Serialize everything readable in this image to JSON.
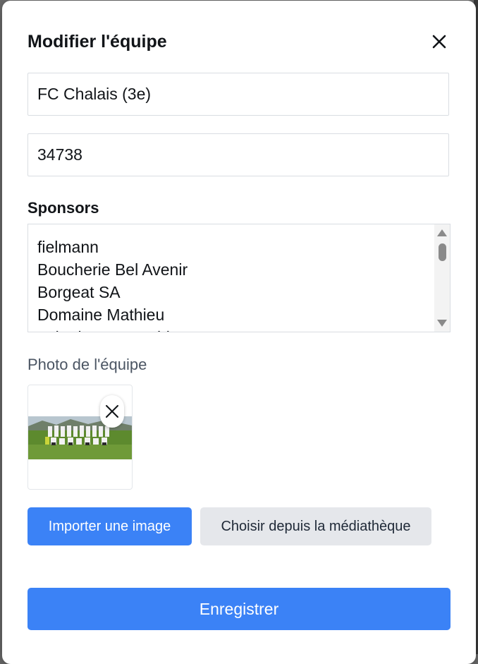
{
  "modal": {
    "title": "Modifier l'équipe",
    "close_icon": "close-icon"
  },
  "form": {
    "team_name": "FC Chalais (3e)",
    "team_id": "34738",
    "sponsors_label": "Sponsors",
    "sponsors": [
      "fielmann",
      "Boucherie Bel Avenir",
      "Borgeat SA",
      "Domaine Mathieu",
      "Laiterie Mont-Noble"
    ],
    "photo_label": "Photo de l'équipe",
    "photo_remove_icon": "close-icon"
  },
  "actions": {
    "import_label": "Importer une image",
    "library_label": "Choisir depuis la médiathèque",
    "save_label": "Enregistrer"
  },
  "colors": {
    "primary": "#3b82f6",
    "secondary": "#e5e7eb",
    "text": "#111418",
    "muted": "#4b5563"
  }
}
